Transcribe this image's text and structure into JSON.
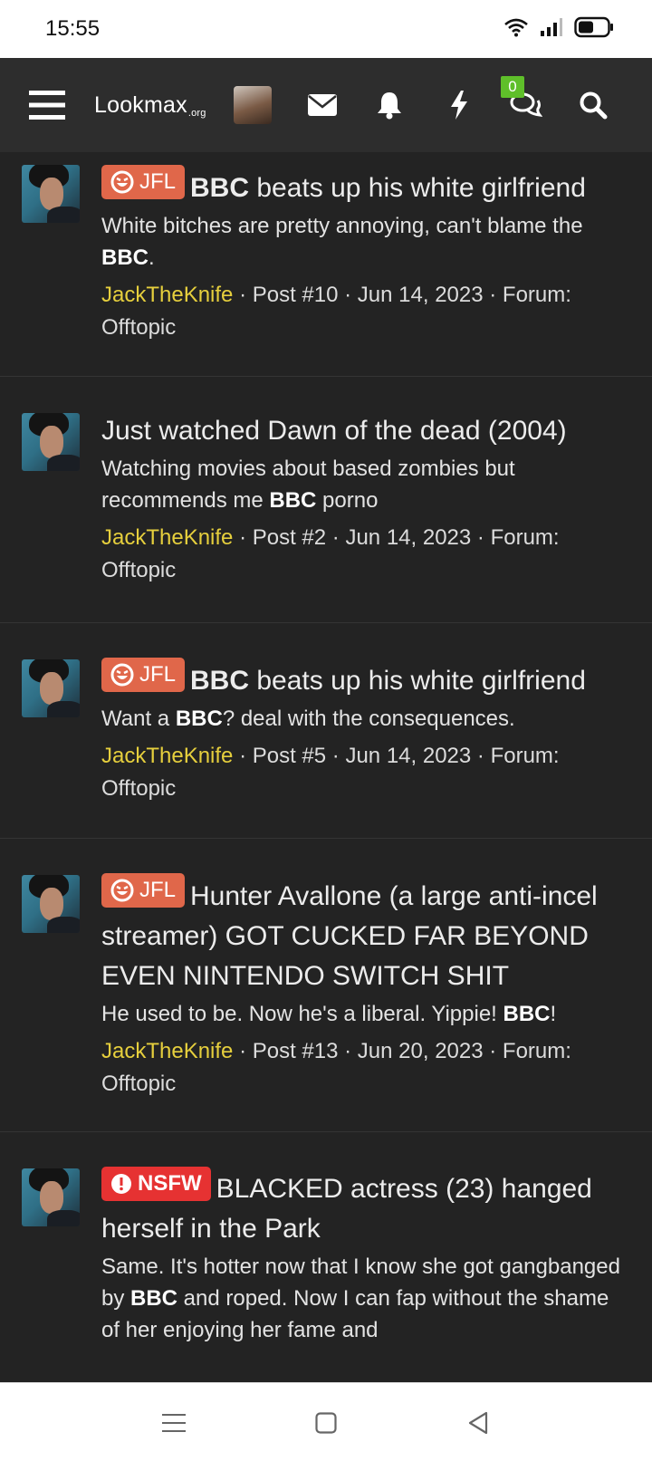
{
  "status_bar": {
    "time": "15:55"
  },
  "navbar": {
    "logo": "Lookmax",
    "logo_suffix": ".org",
    "alerts_badge": "0"
  },
  "posts": [
    {
      "prefix": "JFL",
      "prefix_type": "jfl",
      "title_bold": "BBC",
      "title": " beats up his white girlfriend",
      "snippet_before": "White bitches are pretty annoying, can't blame the ",
      "snippet_bold": "BBC",
      "snippet_after": ".",
      "user": "JackTheKnife",
      "meta": " · Post #10 · Jun 14, 2023 · Forum: Offtopic"
    },
    {
      "prefix": "",
      "prefix_type": "none",
      "title_bold": "",
      "title": "Just watched Dawn of the dead (2004)",
      "snippet_before": "Watching movies about based zombies but recommends me ",
      "snippet_bold": "BBC",
      "snippet_after": " porno",
      "user": "JackTheKnife",
      "meta": " · Post #2 · Jun 14, 2023 · Forum: Offtopic"
    },
    {
      "prefix": "JFL",
      "prefix_type": "jfl",
      "title_bold": "BBC",
      "title": " beats up his white girlfriend",
      "snippet_before": "Want a ",
      "snippet_bold": "BBC",
      "snippet_after": "? deal with the consequences.",
      "user": "JackTheKnife",
      "meta": " · Post #5 · Jun 14, 2023 · Forum: Offtopic"
    },
    {
      "prefix": "JFL",
      "prefix_type": "jfl",
      "title_bold": "",
      "title": "Hunter Avallone (a large anti-incel streamer) GOT CUCKED FAR BEYOND EVEN NINTENDO SWITCH SHIT",
      "snippet_before": "He used to be. Now he's a liberal. Yippie! ",
      "snippet_bold": "BBC",
      "snippet_after": "!",
      "user": "JackTheKnife",
      "meta": " · Post #13 · Jun 20, 2023 · Forum: Offtopic"
    },
    {
      "prefix": "NSFW",
      "prefix_type": "nsfw",
      "title_bold": "",
      "title": "BLACKED actress (23) hanged herself in the Park",
      "snippet_before": "Same. It's hotter now that I know she got gangbanged by ",
      "snippet_bold": "BBC",
      "snippet_after": " and roped. Now I can fap without the shame of her enjoying her fame and",
      "user": "",
      "meta": ""
    }
  ]
}
